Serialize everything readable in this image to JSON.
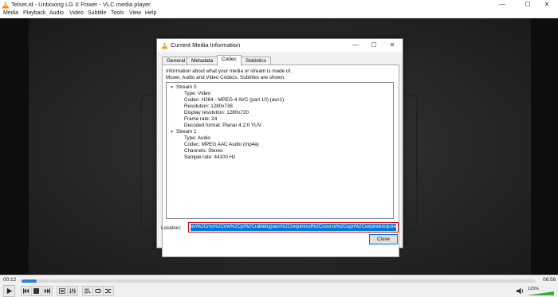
{
  "window": {
    "title": "Telset.id - Unboxing LG X Power - VLC media player",
    "minimize": "—",
    "maximize": "☐",
    "close": "✕"
  },
  "menu": [
    "Media",
    "Playback",
    "Audio",
    "Video",
    "Subtitle",
    "Tools",
    "View",
    "Help"
  ],
  "dialog": {
    "title": "Current Media Information",
    "minimize": "—",
    "maximize": "☐",
    "close": "✕",
    "tabs": [
      "General",
      "Metadata",
      "Codec",
      "Statistics"
    ],
    "active_tab": "Codec",
    "info_line1": "Information about what your media or stream is made of.",
    "info_line2": "Muxer, Audio and Video Codecs, Subtitles are shown.",
    "streams": [
      {
        "label": "Stream 0",
        "fields": [
          "Type: Video",
          "Codec: H264 - MPEG-4 AVC (part 10) (avc1)",
          "Resolution: 1280x738",
          "Display resolution: 1280x720",
          "Frame rate: 24",
          "Decoded format: Planar 4:2:0 YUV"
        ]
      },
      {
        "label": "Stream 1",
        "fields": [
          "Type: Audio",
          "Codec: MPEG AAC Audio (mp4a)",
          "Channels: Stereo",
          "Sample rate: 44100 Hz"
        ]
      }
    ],
    "location_label": "Location:",
    "location_value": "ien%2Cms%2Cmv%2Cpl%2Crablebypass%2Crequiressl%2Csource%2Cupn%2Cexpire&requiressl=yes",
    "close_button": "Close"
  },
  "player": {
    "elapsed": "00:12",
    "total": "06:58",
    "progress_fraction": 0.03,
    "volume": "125%",
    "volume_fraction": 1.0
  },
  "colors": {
    "accent": "#0078d7",
    "highlight_box": "#d10000",
    "seek": "#2f7fd8"
  }
}
